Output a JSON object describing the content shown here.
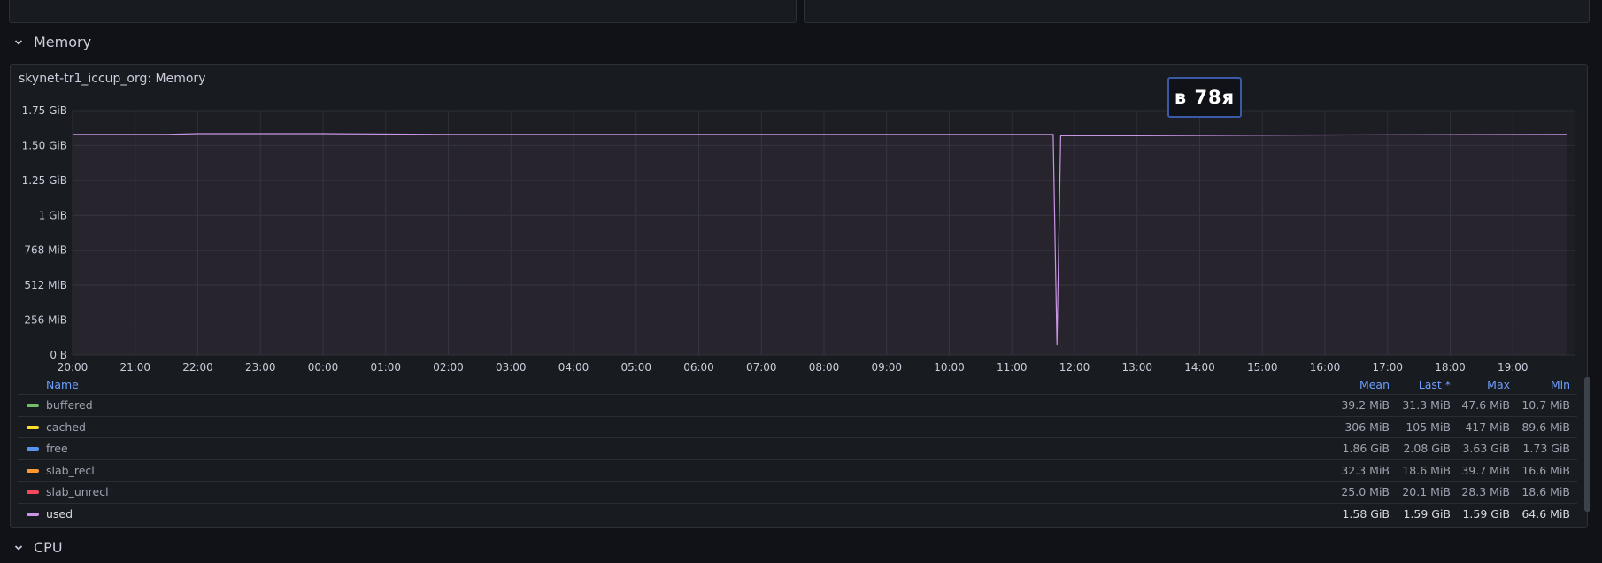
{
  "rows": {
    "memory": "Memory",
    "cpu": "CPU"
  },
  "panel": {
    "title": "skynet-tr1_iccup_org: Memory"
  },
  "badge": "в 78я",
  "chart_data": {
    "type": "line",
    "x": [
      "20:00",
      "21:00",
      "22:00",
      "23:00",
      "00:00",
      "01:00",
      "02:00",
      "03:00",
      "04:00",
      "05:00",
      "06:00",
      "07:00",
      "08:00",
      "09:00",
      "10:00",
      "11:00",
      "12:00",
      "13:00",
      "14:00",
      "15:00",
      "16:00",
      "17:00",
      "18:00",
      "19:00"
    ],
    "y_ticks": [
      "0 B",
      "256 MiB",
      "512 MiB",
      "768 MiB",
      "1 GiB",
      "1.25 GiB",
      "1.50 GiB",
      "1.75 GiB"
    ],
    "ylim": [
      0,
      1.75
    ],
    "y_unit": "GiB",
    "grid": true,
    "series": [
      {
        "name": "used",
        "color": "#ca95e5",
        "points": [
          [
            0,
            1.58
          ],
          [
            1.5,
            1.58
          ],
          [
            2,
            1.585
          ],
          [
            4,
            1.585
          ],
          [
            6,
            1.58
          ],
          [
            8,
            1.58
          ],
          [
            10,
            1.58
          ],
          [
            15.66,
            1.58
          ],
          [
            15.72,
            0.07
          ],
          [
            15.78,
            1.57
          ],
          [
            17,
            1.57
          ],
          [
            19.5,
            1.575
          ],
          [
            23.86,
            1.58
          ]
        ]
      }
    ]
  },
  "legend": {
    "columns": {
      "name": "Name",
      "mean": "Mean",
      "last": "Last *",
      "max": "Max",
      "min": "Min"
    },
    "rows": [
      {
        "name": "buffered",
        "color": "#73bf69",
        "mean": "39.2 MiB",
        "last": "31.3 MiB",
        "max": "47.6 MiB",
        "min": "10.7 MiB"
      },
      {
        "name": "cached",
        "color": "#fade2a",
        "mean": "306 MiB",
        "last": "105 MiB",
        "max": "417 MiB",
        "min": "89.6 MiB"
      },
      {
        "name": "free",
        "color": "#5794f2",
        "mean": "1.86 GiB",
        "last": "2.08 GiB",
        "max": "3.63 GiB",
        "min": "1.73 GiB"
      },
      {
        "name": "slab_recl",
        "color": "#ff9830",
        "mean": "32.3 MiB",
        "last": "18.6 MiB",
        "max": "39.7 MiB",
        "min": "16.6 MiB"
      },
      {
        "name": "slab_unrecl",
        "color": "#f2495c",
        "mean": "25.0 MiB",
        "last": "20.1 MiB",
        "max": "28.3 MiB",
        "min": "18.6 MiB"
      },
      {
        "name": "used",
        "color": "#ca95e5",
        "mean": "1.58 GiB",
        "last": "1.59 GiB",
        "max": "1.59 GiB",
        "min": "64.6 MiB"
      }
    ]
  }
}
